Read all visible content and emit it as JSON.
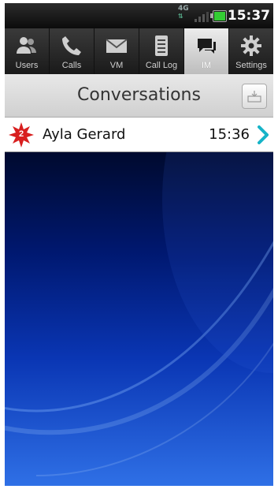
{
  "status_bar": {
    "network": "4G",
    "time": "15:37"
  },
  "tabs": [
    {
      "label": "Users",
      "icon": "users-icon"
    },
    {
      "label": "Calls",
      "icon": "phone-icon"
    },
    {
      "label": "VM",
      "icon": "envelope-icon"
    },
    {
      "label": "Call Log",
      "icon": "call-log-icon"
    },
    {
      "label": "IM",
      "icon": "chat-bubble-icon",
      "active": true
    },
    {
      "label": "Settings",
      "icon": "gear-icon"
    }
  ],
  "header": {
    "title": "Conversations",
    "compose_icon": "compose-message-icon"
  },
  "conversations": [
    {
      "unread_count": "2",
      "name": "Ayla Gerard",
      "time": "15:36"
    }
  ],
  "colors": {
    "badge_red": "#d81f1f",
    "chevron": "#17b4c8",
    "wallpaper_blue": "#0a36b4"
  }
}
